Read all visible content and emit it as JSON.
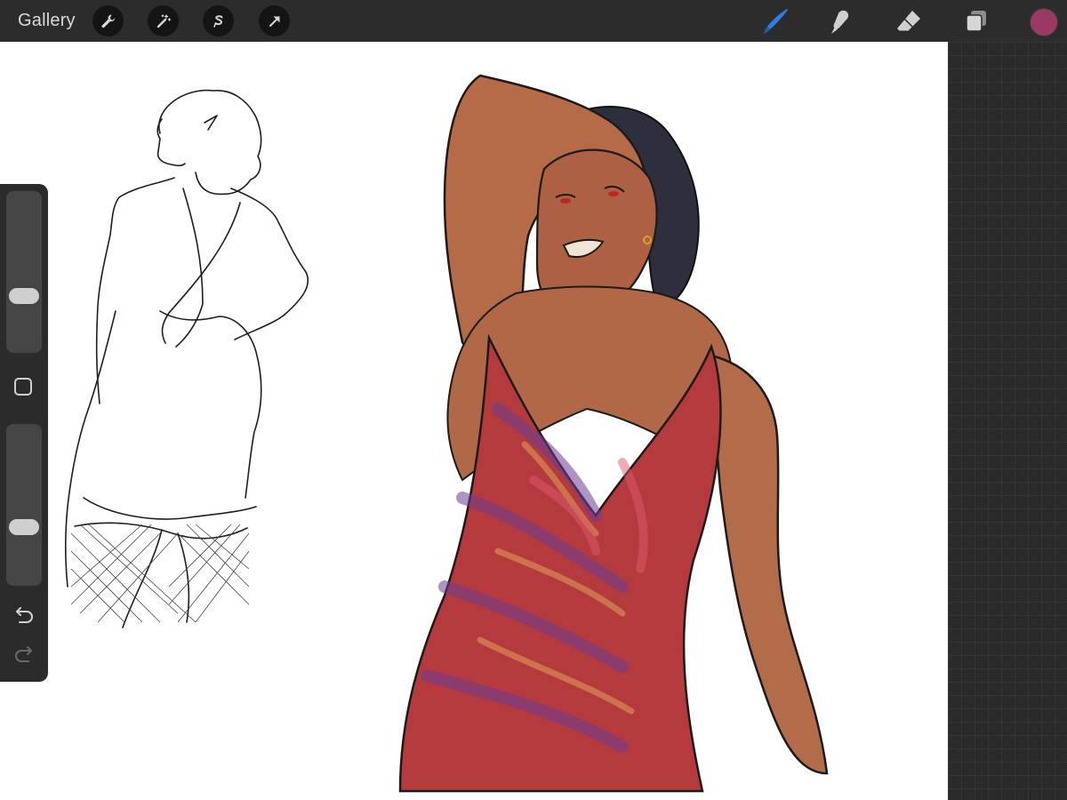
{
  "toolbar": {
    "gallery_label": "Gallery",
    "left_tools": [
      "wrench-icon",
      "magic-wand-icon",
      "selection-icon",
      "transform-arrow-icon"
    ],
    "right_tools": [
      "brush-icon",
      "smudge-icon",
      "eraser-icon",
      "layers-icon"
    ],
    "active_tool": "brush",
    "active_color": "#9a3a64",
    "active_tool_color": "#2f7de1"
  },
  "sidebar": {
    "brush_size_level": 0.67,
    "opacity_level": 0.66,
    "items": [
      "brush-size-slider",
      "modify-button",
      "opacity-slider",
      "undo-icon",
      "redo-icon"
    ]
  },
  "canvas": {
    "background": "#ffffff"
  }
}
